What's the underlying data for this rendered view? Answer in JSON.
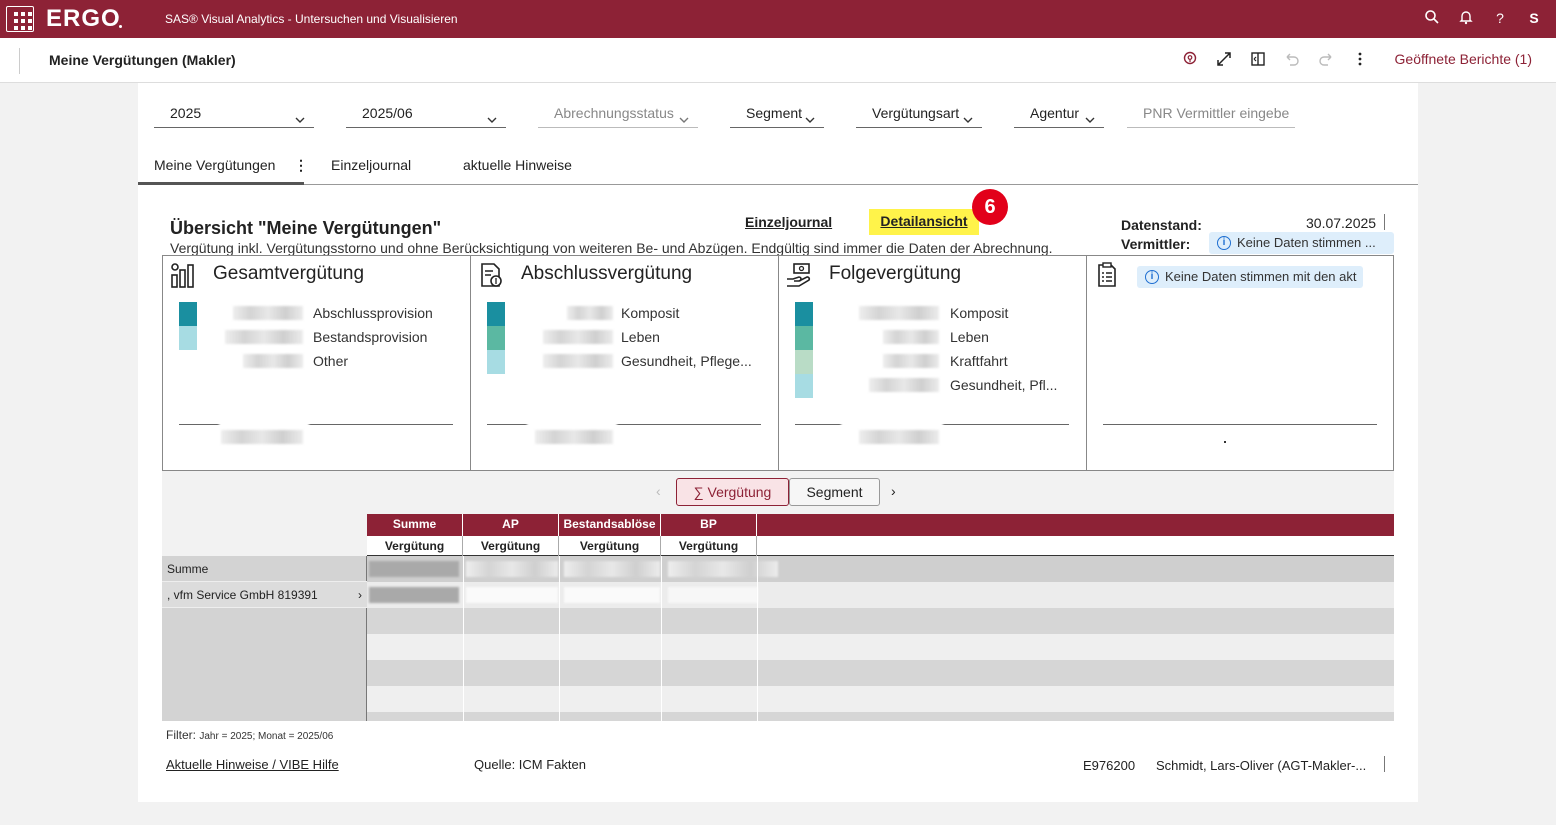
{
  "topbar": {
    "brand": "ERGO",
    "app_title": "SAS® Visual Analytics - Untersuchen und Visualisieren",
    "user_initial": "S",
    "icons": [
      "apps-grid-icon",
      "search-icon",
      "bell-icon",
      "help-icon"
    ]
  },
  "subheader": {
    "report_title": "Meine Vergütungen (Makler)",
    "open_reports": "Geöffnete Berichte (1)",
    "icons": [
      "location-pin-icon",
      "expand-icon",
      "panel-icon",
      "undo-icon",
      "redo-icon",
      "more-vertical-icon"
    ]
  },
  "filters": [
    {
      "label": "2025",
      "disabled": false
    },
    {
      "label": "2025/06",
      "disabled": false
    },
    {
      "label": "Abrechnungsstatus",
      "disabled": true
    },
    {
      "label": "Segment",
      "disabled": false
    },
    {
      "label": "Vergütungsart",
      "disabled": false
    },
    {
      "label": "Agentur",
      "disabled": false
    },
    {
      "label": "PNR Vermittler eingebe",
      "disabled": true
    }
  ],
  "tabs": [
    {
      "label": "Meine Vergütungen",
      "active": true
    },
    {
      "label": "Einzeljournal",
      "active": false
    },
    {
      "label": "aktuelle Hinweise",
      "active": false
    }
  ],
  "overview": {
    "title": "Übersicht \"Meine Vergütungen\"",
    "subtitle": "Vergütung inkl. Vergütungsstorno und ohne Berücksichtigung von weiteren Be- und Abzügen. Endgültig sind immer die Daten der Abrechnung.",
    "link_einzeljournal": "Einzeljournal",
    "link_detailansicht": "Detailansicht",
    "step_badge": "6",
    "datenstand_label": "Datenstand:",
    "datenstand_value": "30.07.2025",
    "vermittler_label": "Vermittler:",
    "vermittler_info": "Keine Daten stimmen ..."
  },
  "cards": [
    {
      "title": "Gesamtvergütung",
      "icon": "bar-chart-icon",
      "items": [
        {
          "label": "Abschlussprovision",
          "color": "#1a8fa0"
        },
        {
          "label": "Bestandsprovision",
          "color": "#a7dce3"
        },
        {
          "label": "Other",
          "color": null
        }
      ]
    },
    {
      "title": "Abschlussvergütung",
      "icon": "document-money-icon",
      "items": [
        {
          "label": "Komposit",
          "color": "#1a8fa0"
        },
        {
          "label": "Leben",
          "color": "#5bb8a2"
        },
        {
          "label": "Gesundheit, Pflege...",
          "color": "#a7dce3"
        }
      ]
    },
    {
      "title": "Folgevergütung",
      "icon": "hand-money-icon",
      "items": [
        {
          "label": "Komposit",
          "color": "#1a8fa0"
        },
        {
          "label": "Leben",
          "color": "#5bb8a2"
        },
        {
          "label": "Kraftfahrt",
          "color": "#b9dcc6"
        },
        {
          "label": "Gesundheit, Pfl...",
          "color": "#a7dce3"
        }
      ]
    },
    {
      "title": "",
      "icon": "document-list-icon",
      "info": "Keine Daten stimmen mit den akt",
      "items": []
    }
  ],
  "segment_buttons": [
    {
      "label": "∑ Vergütung",
      "active": true
    },
    {
      "label": "Segment",
      "active": false
    }
  ],
  "table": {
    "headers": [
      "Summe",
      "AP",
      "Bestandsablöse",
      "BP"
    ],
    "subheaders": [
      "Vergütung",
      "Vergütung",
      "Vergütung",
      "Vergütung"
    ],
    "rows": [
      {
        "label": "Summe",
        "expandable": false
      },
      {
        "label": ", vfm Service GmbH 819391",
        "expandable": true
      }
    ]
  },
  "footer": {
    "filter_label": "Filter:",
    "filter_value": "Jahr = 2025; Monat = 2025/06",
    "help_link": "Aktuelle Hinweise / VIBE Hilfe",
    "source": "Quelle: ICM Fakten",
    "user_id": "E976200",
    "user_name": "Schmidt, Lars-Oliver (AGT-Makler-..."
  }
}
